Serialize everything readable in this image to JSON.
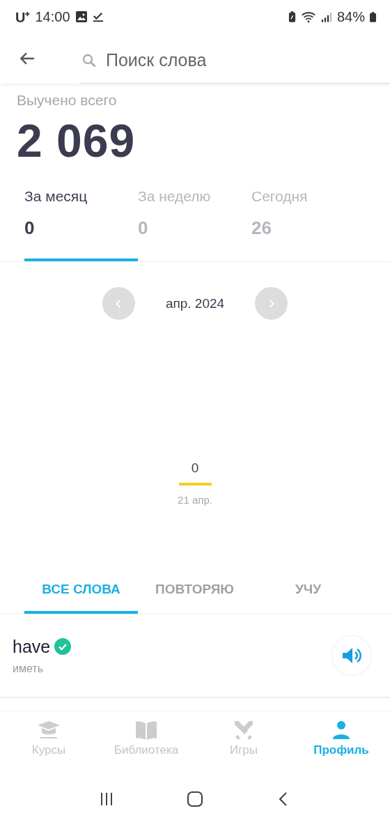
{
  "status_bar": {
    "carrier": "U⁺",
    "time": "14:00",
    "battery": "84%"
  },
  "search": {
    "placeholder": "Поиск слова"
  },
  "total": {
    "label": "Выучено всего",
    "value": "2 069"
  },
  "period_tabs": [
    {
      "label": "За месяц",
      "value": "0",
      "selected": true
    },
    {
      "label": "За неделю",
      "value": "0",
      "selected": false
    },
    {
      "label": "Сегодня",
      "value": "26",
      "selected": false
    }
  ],
  "month_nav": {
    "label": "апр. 2024"
  },
  "day_bar": {
    "value": "0",
    "date": "21 апр."
  },
  "word_tabs": [
    {
      "label": "ВСЕ СЛОВА",
      "selected": true
    },
    {
      "label": "ПОВТОРЯЮ",
      "selected": false
    },
    {
      "label": "УЧУ",
      "selected": false
    }
  ],
  "words": [
    {
      "word": "have",
      "translation": "иметь",
      "learned": true
    }
  ],
  "bottom_nav": [
    {
      "label": "Курсы",
      "kind": "courses",
      "selected": false
    },
    {
      "label": "Библиотека",
      "kind": "library",
      "selected": false
    },
    {
      "label": "Игры",
      "kind": "games",
      "selected": false
    },
    {
      "label": "Профиль",
      "kind": "profile",
      "selected": true
    }
  ]
}
